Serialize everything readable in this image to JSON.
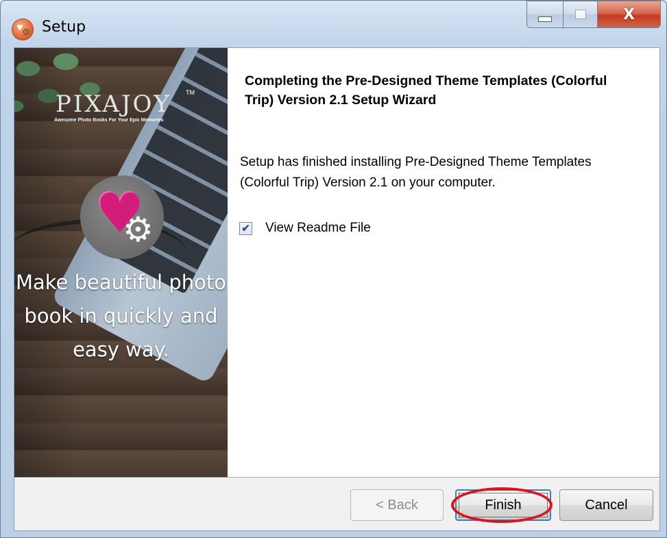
{
  "window": {
    "title": "Setup",
    "minimize_glyph": "",
    "maximize_glyph": "",
    "close_glyph": "X"
  },
  "banner": {
    "logo": "PIXAJOY",
    "logo_tm": "TM",
    "logo_tagline": "Awesome Photo Books For Your Epic Memories",
    "tagline": "Make beautiful photo book in quickly and easy way."
  },
  "content": {
    "heading": "Completing the Pre-Designed Theme Templates (Colorful Trip) Version 2.1 Setup Wizard",
    "body": "Setup has finished installing Pre-Designed Theme Templates (Colorful Trip) Version 2.1 on your computer.",
    "readme_checkbox": {
      "label": "View Readme File",
      "checked": true,
      "check_glyph": "✔"
    }
  },
  "buttons": {
    "back": "< Back",
    "finish": "Finish",
    "cancel": "Cancel"
  },
  "colors": {
    "highlight_ring": "#e0121b",
    "heart": "#d41c7a"
  },
  "icons": {
    "app": "setup-app-icon",
    "badge": "heart-gear-icon"
  }
}
